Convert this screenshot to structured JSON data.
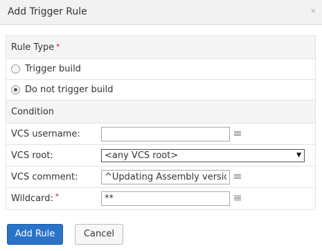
{
  "dialog": {
    "title": "Add Trigger Rule",
    "close_glyph": "×"
  },
  "rule_type": {
    "header": "Rule Type",
    "required_mark": "*",
    "options": [
      {
        "label": "Trigger build",
        "checked": false
      },
      {
        "label": "Do not trigger build",
        "checked": true
      }
    ]
  },
  "condition": {
    "header": "Condition",
    "fields": {
      "vcs_username": {
        "label": "VCS username:",
        "value": ""
      },
      "vcs_root": {
        "label": "VCS root:",
        "selected": "<any VCS root>"
      },
      "vcs_comment": {
        "label": "VCS comment:",
        "value": "^Updating Assembly version"
      },
      "wildcard": {
        "label": "Wildcard:",
        "required_mark": "*",
        "value": "**"
      }
    }
  },
  "buttons": {
    "add_rule": "Add Rule",
    "cancel": "Cancel"
  },
  "colors": {
    "primary": "#2a73c9",
    "required": "#cc0000"
  },
  "icons": {
    "list": "list-icon",
    "dropdown": "triangle-down-icon",
    "close": "close-icon"
  }
}
